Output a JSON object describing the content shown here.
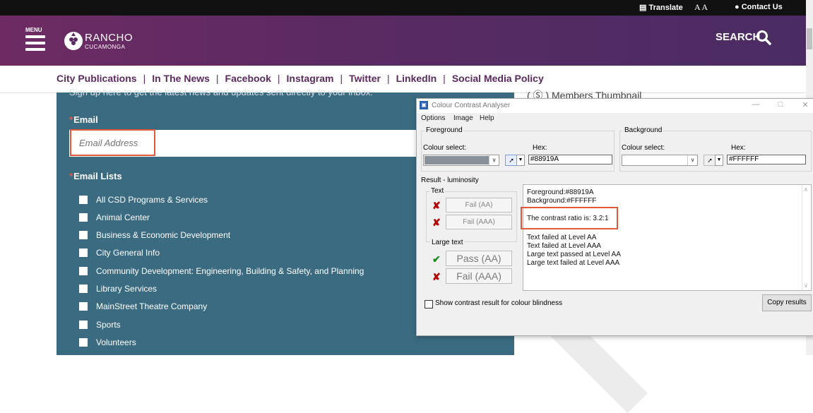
{
  "utility": {
    "translate": "Translate",
    "aa": "A A",
    "contact": "Contact Us"
  },
  "header": {
    "menu_label": "MENU",
    "logo_line1": "RANCHO",
    "logo_line2": "CUCAMONGA",
    "search_label": "SEARCH"
  },
  "nav": [
    "City Publications",
    "In The News",
    "Facebook",
    "Instagram",
    "Twitter",
    "LinkedIn",
    "Social Media Policy"
  ],
  "nav_separator": "|",
  "form": {
    "intro_cut": "Sign up here to get the latest news and updates sent directly to your inbox.",
    "required_mark": "*",
    "email_label": "Email",
    "email_placeholder": "Email Address",
    "lists_label": "Email Lists",
    "lists": [
      "All CSD Programs & Services",
      "Animal Center",
      "Business & Economic Development",
      "City General Info",
      "Community Development: Engineering, Building & Safety, and Planning",
      "Library Services",
      "MainStreet Theatre Company",
      "Sports",
      "Volunteers"
    ]
  },
  "behind_text": "( Ⓢ )  Members Thumbnail",
  "dialog": {
    "title": "Colour Contrast Analyser",
    "menu": [
      "Options",
      "Image",
      "Help"
    ],
    "foreground": {
      "group": "Foreground",
      "colour_select_label": "Colour select:",
      "hex_label": "Hex:",
      "hex_value": "#88919A",
      "swatch": "#88919a"
    },
    "background": {
      "group": "Background",
      "colour_select_label": "Colour select:",
      "hex_label": "Hex:",
      "hex_value": "#FFFFFF",
      "swatch": "#ffffff"
    },
    "result_group": "Result - luminosity",
    "text_group": "Text",
    "text_results": [
      "Fail (AA)",
      "Fail (AAA)"
    ],
    "large_group": "Large text",
    "large_results": [
      "Pass (AA)",
      "Fail (AAA)"
    ],
    "result_lines": [
      "Foreground:#88919A",
      "Background:#FFFFFF",
      "The contrast ratio is: 3.2:1",
      "Text failed at Level AA",
      "Text failed at Level AAA",
      "Large text passed at Level AA",
      "Large text failed at Level AAA"
    ],
    "colour_blind_label": "Show contrast result for colour blindness",
    "copy_button": "Copy results"
  }
}
